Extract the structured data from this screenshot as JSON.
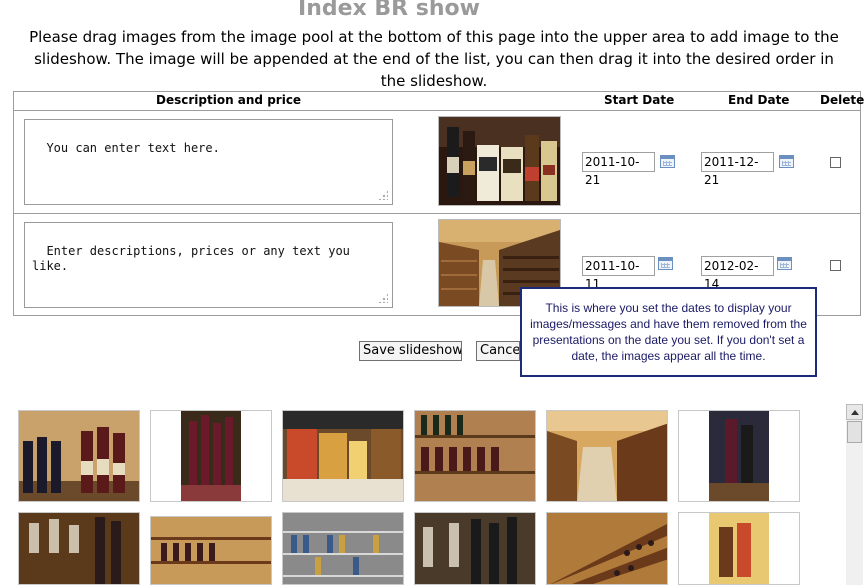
{
  "page": {
    "title": "Index BR show",
    "intro": "Please drag images from the image pool at the bottom of this page into the upper area to add image to the slideshow. The image will be appended at the end of the list, you can then drag it into the desired order in the slideshow."
  },
  "table": {
    "headers": {
      "description": "Description and price",
      "start": "Start Date",
      "end": "End Date",
      "delete": "Delete"
    },
    "rows": [
      {
        "description": "You can enter text here.",
        "start_date": "2011-10-21",
        "end_date": "2011-12-21",
        "image": "beer-six-pack-photo"
      },
      {
        "description": "Enter descriptions, prices or any text you like.",
        "start_date": "2011-10-11",
        "end_date": "2012-02-14",
        "image": "wine-store-aisle-photo"
      }
    ]
  },
  "buttons": {
    "save": "Save slideshow",
    "cancel": "Cancel"
  },
  "tooltip": "This is where you set the dates to display your images/messages and have them removed from the presentations on the date you set. If you don't set a date, the images appear all the time.",
  "pool": {
    "images": [
      "wine-bottles-shelf",
      "wine-bottles-portrait",
      "beer-packs-glass",
      "wine-rack-shelf",
      "store-interior",
      "wine-bottle-portrait",
      "wine-glasses",
      "wine-shelves",
      "liquor-shelves",
      "wine-glasses-bottles",
      "wine-rack-angle",
      "gift-basket"
    ]
  },
  "colors": {
    "title": "#9a9a9a",
    "tooltip_border": "#1c2a7a",
    "tooltip_text": "#1a1a66"
  }
}
